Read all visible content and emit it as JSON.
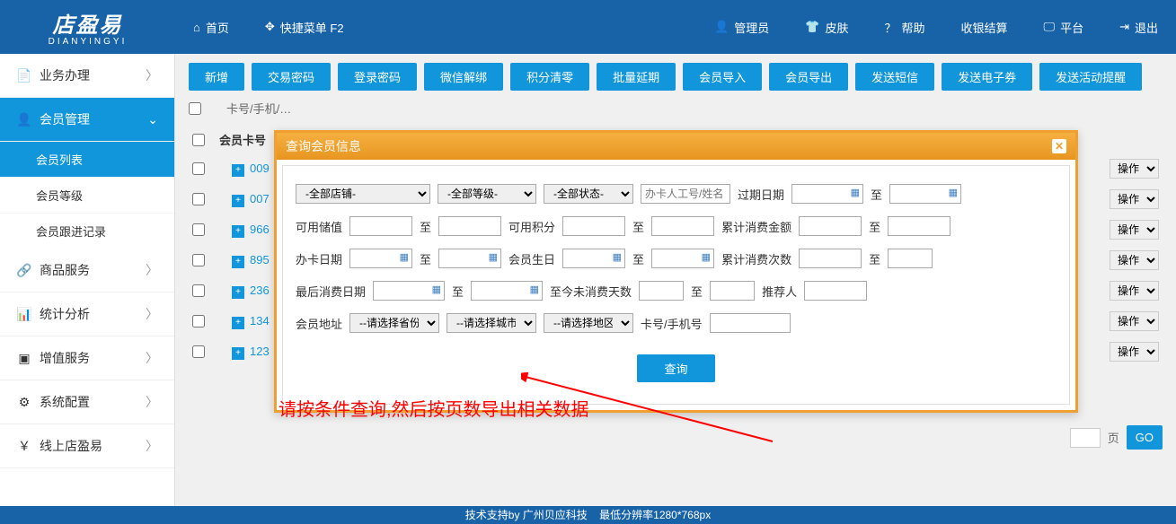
{
  "brand": {
    "name": "店盈易",
    "sub": "DIANYINGYI"
  },
  "header": {
    "home": "首页",
    "quick": "快捷菜单 F2",
    "admin": "管理员",
    "skin": "皮肤",
    "help": "帮助",
    "settle": "收银结算",
    "platform": "平台",
    "exit": "退出"
  },
  "sidebar": {
    "biz": "业务办理",
    "member": "会员管理",
    "member_list": "会员列表",
    "member_level": "会员等级",
    "member_track": "会员跟进记录",
    "product": "商品服务",
    "stats": "统计分析",
    "valueadd": "增值服务",
    "sysconf": "系统配置",
    "online": "线上店盈易"
  },
  "toolbar": {
    "new": "新增",
    "txpwd": "交易密码",
    "loginpwd": "登录密码",
    "wxunbind": "微信解绑",
    "pointclear": "积分清零",
    "batchdelay": "批量延期",
    "import": "会员导入",
    "export": "会员导出",
    "sms": "发送短信",
    "ecoupon": "发送电子券",
    "actremind": "发送活动提醒"
  },
  "search_placeholder": "卡号/手机/…",
  "table": {
    "col_card": "会员卡号",
    "op": "操作",
    "rows": [
      "009",
      "007",
      "966",
      "895",
      "236",
      "134",
      "123"
    ]
  },
  "modal": {
    "title": "查询会员信息",
    "store": "-全部店铺-",
    "level": "-全部等级-",
    "status": "-全部状态-",
    "opener_ph": "办卡人工号/姓名",
    "expire": "过期日期",
    "to": "至",
    "balance": "可用储值",
    "points": "可用积分",
    "total_amount": "累计消费金额",
    "card_date": "办卡日期",
    "birthday": "会员生日",
    "total_count": "累计消费次数",
    "last_date": "最后消费日期",
    "no_consume": "至今未消费天数",
    "referrer": "推荐人",
    "address": "会员地址",
    "province": "--请选择省份",
    "city": "--请选择城市",
    "district": "--请选择地区",
    "cardphone": "卡号/手机号",
    "submit": "查询"
  },
  "annotation": "请按条件查询,然后按页数导出相关数据",
  "pager": {
    "page_suffix": "页",
    "go": "GO"
  },
  "footer": {
    "support": "技术支持by 广州贝应科技",
    "res": "最低分辨率1280*768px"
  }
}
